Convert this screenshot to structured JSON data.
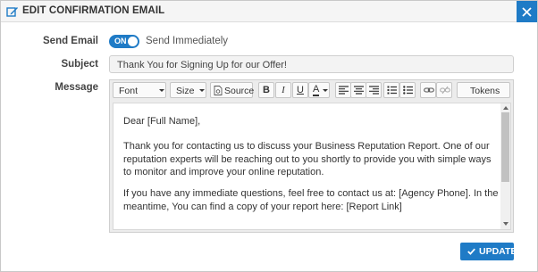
{
  "dialog": {
    "title": "EDIT CONFIRMATION EMAIL"
  },
  "form": {
    "send_email_label": "Send Email",
    "toggle_state": "ON",
    "toggle_text": "Send Immediately",
    "subject_label": "Subject",
    "subject_value": "Thank You for Signing Up for our Offer!",
    "message_label": "Message"
  },
  "toolbar": {
    "font_label": "Font",
    "size_label": "Size",
    "source_label": "Source",
    "bold": "B",
    "italic": "I",
    "underline": "U",
    "text_color": "A",
    "tokens_label": "Tokens"
  },
  "message": {
    "paragraphs": [
      "Dear [Full Name],",
      "Thank you for contacting us to discuss your Business Reputation Report. One of our reputation experts will be reaching out to you shortly to provide you with simple ways to monitor and improve your online reputation.",
      "If you have any immediate questions, feel free to contact us at: [Agency Phone]. In the meantime, You can find a copy of your report here: [Report Link]"
    ]
  },
  "actions": {
    "update_label": "UPDATE"
  },
  "colors": {
    "accent": "#1f7bc6"
  }
}
